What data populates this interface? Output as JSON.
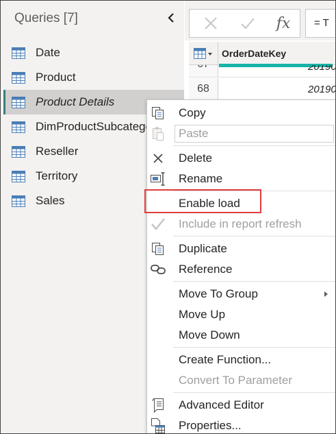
{
  "queries_pane": {
    "title": "Queries [7]",
    "collapse_icon": "chevron-left-icon",
    "items": [
      {
        "label": "Date",
        "icon": "table-icon",
        "selected": false
      },
      {
        "label": "Product",
        "icon": "table-icon",
        "selected": false
      },
      {
        "label": "Product Details",
        "icon": "table-icon",
        "selected": true
      },
      {
        "label": "DimProductSubcategory",
        "icon": "table-icon",
        "selected": false
      },
      {
        "label": "Reseller",
        "icon": "table-icon",
        "selected": false
      },
      {
        "label": "Territory",
        "icon": "table-icon",
        "selected": false
      },
      {
        "label": "Sales",
        "icon": "table-icon",
        "selected": false
      }
    ]
  },
  "formula_bar": {
    "cancel_icon": "close-icon",
    "commit_icon": "check-icon",
    "fx_icon": "fx-icon",
    "formula_text": "= T"
  },
  "grid": {
    "column_header": "OrderDateKey",
    "rows": [
      {
        "num": "67",
        "value": "20190"
      },
      {
        "num": "68",
        "value": "20190"
      }
    ]
  },
  "context_menu": {
    "items": [
      {
        "label": "Copy",
        "icon": "copy-icon",
        "disabled": false
      },
      {
        "label": "Paste",
        "icon": "paste-icon",
        "disabled": true
      },
      {
        "label": "Delete",
        "icon": "delete-icon",
        "disabled": false
      },
      {
        "label": "Rename",
        "icon": "rename-icon",
        "disabled": false
      },
      {
        "label": "Enable load",
        "icon": "",
        "disabled": false,
        "highlighted": true
      },
      {
        "label": "Include in report refresh",
        "icon": "check-icon",
        "disabled": true
      },
      {
        "label": "Duplicate",
        "icon": "duplicate-icon",
        "disabled": false
      },
      {
        "label": "Reference",
        "icon": "reference-icon",
        "disabled": false
      },
      {
        "label": "Move To Group",
        "icon": "",
        "disabled": false,
        "submenu": true
      },
      {
        "label": "Move Up",
        "icon": "",
        "disabled": false
      },
      {
        "label": "Move Down",
        "icon": "",
        "disabled": false
      },
      {
        "label": "Create Function...",
        "icon": "",
        "disabled": false
      },
      {
        "label": "Convert To Parameter",
        "icon": "",
        "disabled": true
      },
      {
        "label": "Advanced Editor",
        "icon": "advanced-editor-icon",
        "disabled": false
      },
      {
        "label": "Properties...",
        "icon": "properties-icon",
        "disabled": false
      }
    ]
  },
  "colors": {
    "accent_teal": "#17b3a6",
    "highlight_red": "#e03c3c",
    "pane_bg": "#f3f2f1",
    "selected_bg": "#d2d0ce"
  }
}
